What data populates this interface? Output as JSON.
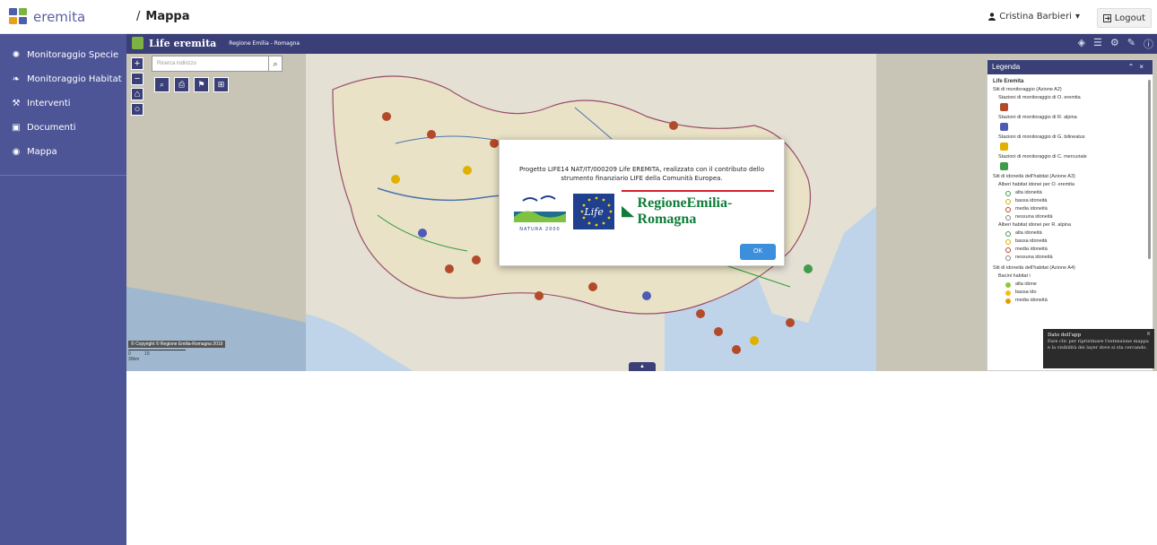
{
  "header": {
    "logo_text": "eremita",
    "breadcrumb_sep": "/",
    "page_title": "Mappa",
    "user_name": "Cristina Barbieri",
    "user_caret": "▾",
    "logout_label": "Logout"
  },
  "sidebar": {
    "items": [
      {
        "label": "Monitoraggio Specie",
        "icon": "bug-icon"
      },
      {
        "label": "Monitoraggio Habitat",
        "icon": "leaf-icon"
      },
      {
        "label": "Interventi",
        "icon": "wrench-icon"
      },
      {
        "label": "Documenti",
        "icon": "document-icon"
      },
      {
        "label": "Mappa",
        "icon": "map-marker-icon"
      }
    ]
  },
  "map": {
    "app_title": "Life eremita",
    "app_subtitle": "Regione Emilia - Romagna",
    "search_placeholder": "Ricerca indirizzo",
    "copyright": "© Copyright © Regione Emilia-Romagna 2019",
    "scale_labels": [
      "0",
      "15",
      "30km"
    ]
  },
  "legend": {
    "title": "Legenda",
    "group_title": "Life Eremita",
    "section1": "Siti di monitoraggio (Azione A2)",
    "stations": [
      {
        "label": "Stazioni di monitoraggio di O. eremita",
        "color": "#b34a2a"
      },
      {
        "label": "Stazioni di monitoraggio di R. alpina",
        "color": "#4e5bb5"
      },
      {
        "label": "Stazioni di monitoraggio di G. bilineatus",
        "color": "#e0b100"
      },
      {
        "label": "Stazioni di monitoraggio di C. mercuriale",
        "color": "#3f9c4a"
      }
    ],
    "section2": "Siti di idoneità dell'habitat (Azione A3)",
    "group_oe": "Alberi habitat idonei per O. eremita",
    "group_ra": "Alberi habitat idonei per R. alpina",
    "suitability": [
      {
        "label": "alta idoneità",
        "color": "#3f9c4a"
      },
      {
        "label": "bassa idoneità",
        "color": "#e8a800"
      },
      {
        "label": "media idoneità",
        "color": "#b34a2a"
      },
      {
        "label": "nessuna idoneità",
        "color": "#888888"
      }
    ],
    "section3": "Siti di idoneità dell'habitat (Azione A4)",
    "group_basins": "Bacini habitat i",
    "basins": [
      {
        "label": "alta idone",
        "color": "#8cc63f"
      },
      {
        "label": "bassa ido",
        "color": "#f2c200"
      },
      {
        "label": "media idoneità",
        "color": "#e89a00"
      }
    ]
  },
  "tooltip": {
    "title": "Dato dell'app",
    "text": "Fare clic per ripristinare l'estensione mappa e la visibilità dei layer dove si sta cercando."
  },
  "modal": {
    "message": "Progetto LIFE14 NAT/IT/000209 Life EREMITA, realizzato con il contributo dello strumento finanziario LIFE della Comunità Europea.",
    "natura_label": "NATURA 2000",
    "life_label": "Life",
    "region_label": "RegioneEmilia-Romagna",
    "ok_label": "OK"
  },
  "colors": {
    "sidebar_bg": "#4d5597",
    "map_header_bg": "#3a3f78",
    "ok_button": "#3c8fdc"
  }
}
